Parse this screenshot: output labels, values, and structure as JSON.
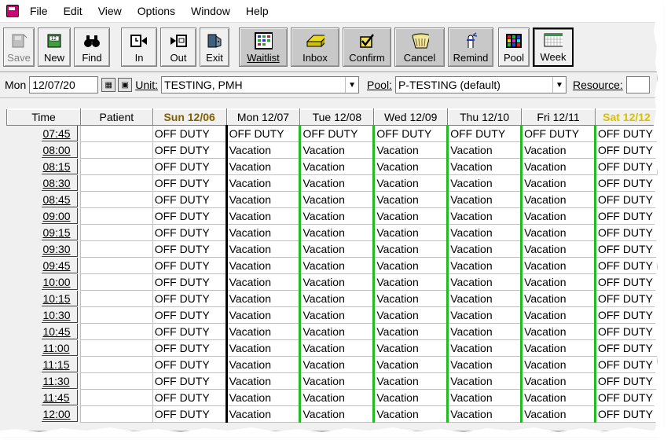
{
  "menu": [
    "File",
    "Edit",
    "View",
    "Options",
    "Window",
    "Help"
  ],
  "toolbar": {
    "save": "Save",
    "new": "New",
    "find": "Find",
    "in": "In",
    "out": "Out",
    "exit": "Exit",
    "waitlist": "Waitlist",
    "inbox": "Inbox",
    "confirm": "Confirm",
    "cancel": "Cancel",
    "remind": "Remind",
    "pool": "Pool",
    "week": "Week"
  },
  "filter": {
    "day": "Mon",
    "date": "12/07/20",
    "unit_label": "Unit:",
    "unit_value": "TESTING, PMH",
    "pool_label": "Pool:",
    "pool_value": "P-TESTING (default)",
    "resource_label": "Resource:"
  },
  "grid": {
    "headers": [
      "Time",
      "Patient",
      "Sun 12/06",
      "Mon 12/07",
      "Tue 12/08",
      "Wed 12/09",
      "Thu 12/10",
      "Fri 12/11",
      "Sat 12/12"
    ],
    "rows": [
      {
        "time": "07:45",
        "cells": [
          "OFF DUTY",
          "OFF DUTY",
          "OFF DUTY",
          "OFF DUTY",
          "OFF DUTY",
          "OFF DUTY",
          "OFF DUTY"
        ]
      },
      {
        "time": "08:00",
        "cells": [
          "OFF DUTY",
          "Vacation",
          "Vacation",
          "Vacation",
          "Vacation",
          "Vacation",
          "OFF DUTY"
        ]
      },
      {
        "time": "08:15",
        "cells": [
          "OFF DUTY",
          "Vacation",
          "Vacation",
          "Vacation",
          "Vacation",
          "Vacation",
          "OFF DUTY"
        ]
      },
      {
        "time": "08:30",
        "cells": [
          "OFF DUTY",
          "Vacation",
          "Vacation",
          "Vacation",
          "Vacation",
          "Vacation",
          "OFF DUTY"
        ]
      },
      {
        "time": "08:45",
        "cells": [
          "OFF DUTY",
          "Vacation",
          "Vacation",
          "Vacation",
          "Vacation",
          "Vacation",
          "OFF DUTY"
        ]
      },
      {
        "time": "09:00",
        "cells": [
          "OFF DUTY",
          "Vacation",
          "Vacation",
          "Vacation",
          "Vacation",
          "Vacation",
          "OFF DUTY"
        ]
      },
      {
        "time": "09:15",
        "cells": [
          "OFF DUTY",
          "Vacation",
          "Vacation",
          "Vacation",
          "Vacation",
          "Vacation",
          "OFF DUTY"
        ]
      },
      {
        "time": "09:30",
        "cells": [
          "OFF DUTY",
          "Vacation",
          "Vacation",
          "Vacation",
          "Vacation",
          "Vacation",
          "OFF DUTY"
        ]
      },
      {
        "time": "09:45",
        "cells": [
          "OFF DUTY",
          "Vacation",
          "Vacation",
          "Vacation",
          "Vacation",
          "Vacation",
          "OFF DUTY"
        ]
      },
      {
        "time": "10:00",
        "cells": [
          "OFF DUTY",
          "Vacation",
          "Vacation",
          "Vacation",
          "Vacation",
          "Vacation",
          "OFF DUTY"
        ]
      },
      {
        "time": "10:15",
        "cells": [
          "OFF DUTY",
          "Vacation",
          "Vacation",
          "Vacation",
          "Vacation",
          "Vacation",
          "OFF DUTY"
        ]
      },
      {
        "time": "10:30",
        "cells": [
          "OFF DUTY",
          "Vacation",
          "Vacation",
          "Vacation",
          "Vacation",
          "Vacation",
          "OFF DUTY"
        ]
      },
      {
        "time": "10:45",
        "cells": [
          "OFF DUTY",
          "Vacation",
          "Vacation",
          "Vacation",
          "Vacation",
          "Vacation",
          "OFF DUTY"
        ]
      },
      {
        "time": "11:00",
        "cells": [
          "OFF DUTY",
          "Vacation",
          "Vacation",
          "Vacation",
          "Vacation",
          "Vacation",
          "OFF DUTY"
        ]
      },
      {
        "time": "11:15",
        "cells": [
          "OFF DUTY",
          "Vacation",
          "Vacation",
          "Vacation",
          "Vacation",
          "Vacation",
          "OFF DUTY"
        ]
      },
      {
        "time": "11:30",
        "cells": [
          "OFF DUTY",
          "Vacation",
          "Vacation",
          "Vacation",
          "Vacation",
          "Vacation",
          "OFF DUTY"
        ]
      },
      {
        "time": "11:45",
        "cells": [
          "OFF DUTY",
          "Vacation",
          "Vacation",
          "Vacation",
          "Vacation",
          "Vacation",
          "OFF DUTY"
        ]
      },
      {
        "time": "12:00",
        "cells": [
          "OFF DUTY",
          "Vacation",
          "Vacation",
          "Vacation",
          "Vacation",
          "Vacation",
          "OFF DUTY"
        ]
      }
    ]
  },
  "colors": {
    "sun_header": "#806000",
    "sat_header": "#d8c000",
    "mon_divider": "#000000",
    "weekday_divider": "#22bb22"
  }
}
